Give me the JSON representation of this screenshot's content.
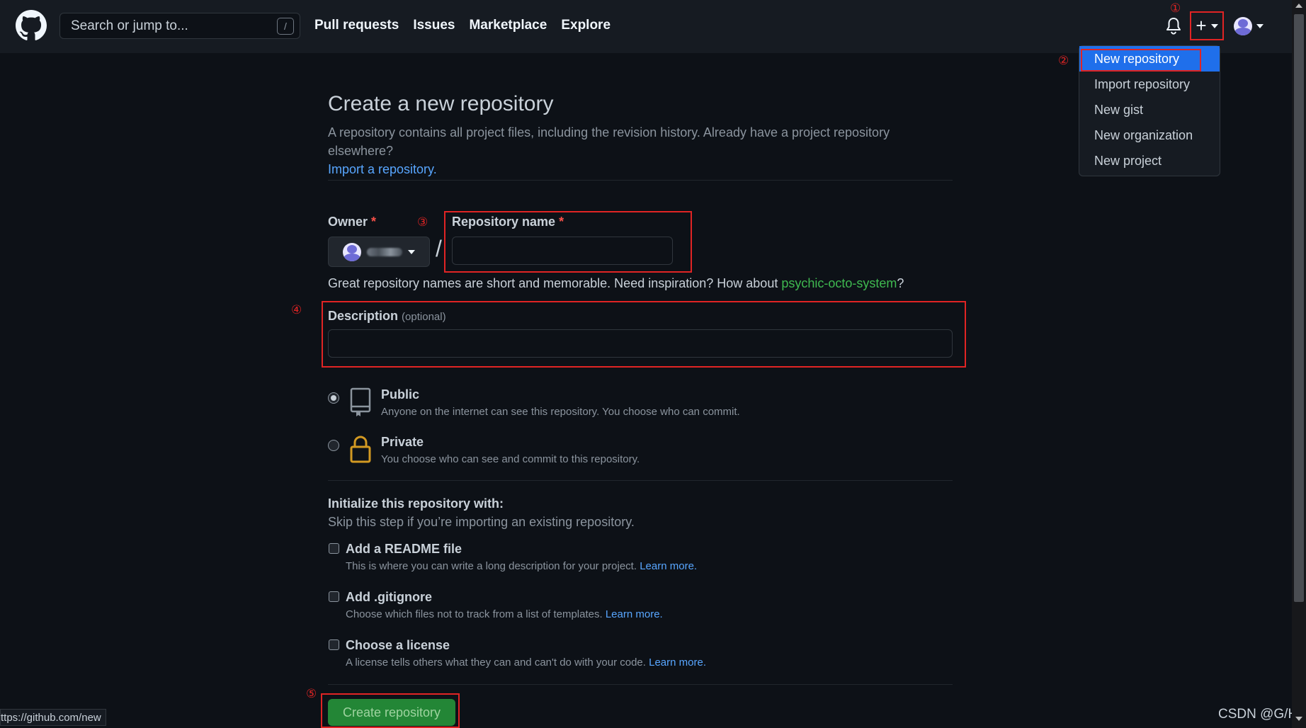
{
  "header": {
    "search_placeholder": "Search or jump to...",
    "search_shortcut": "/",
    "nav": [
      "Pull requests",
      "Issues",
      "Marketplace",
      "Explore"
    ],
    "plus_label": "+"
  },
  "annotations": [
    "①",
    "②",
    "③",
    "④",
    "⑤"
  ],
  "dropdown": {
    "items": [
      "New repository",
      "Import repository",
      "New gist",
      "New organization",
      "New project"
    ]
  },
  "main": {
    "title": "Create a new repository",
    "subtitle": "A repository contains all project files, including the revision history. Already have a project repository elsewhere?",
    "import_link": "Import a repository.",
    "owner_label": "Owner",
    "required_mark": "*",
    "slash": "/",
    "repo_name_label": "Repository name",
    "hint_prefix": "Great repository names are short and memorable. Need inspiration? How about ",
    "hint_suggestion": "psychic-octo-system",
    "hint_suffix": "?",
    "description_label": "Description",
    "description_optional": "(optional)",
    "visibility": {
      "public_title": "Public",
      "public_desc": "Anyone on the internet can see this repository. You choose who can commit.",
      "private_title": "Private",
      "private_desc": "You choose who can see and commit to this repository."
    },
    "init_title": "Initialize this repository with:",
    "init_subtitle": "Skip this step if you’re importing an existing repository.",
    "readme_title": "Add a README file",
    "readme_desc": "This is where you can write a long description for your project.",
    "gitignore_title": "Add .gitignore",
    "gitignore_desc": "Choose which files not to track from a list of templates.",
    "license_title": "Choose a license",
    "license_desc": "A license tells others what they can and can't do with your code.",
    "learn_more": "Learn more.",
    "create_button": "Create repository"
  },
  "status_url": "ttps://github.com/new",
  "watermark": "CSDN @G/H",
  "colors": {
    "background": "#0d1117",
    "header": "#161b22",
    "accent_blue": "#1f6feb",
    "link": "#58a6ff",
    "green": "#238636",
    "annotation_red": "#e02424"
  }
}
